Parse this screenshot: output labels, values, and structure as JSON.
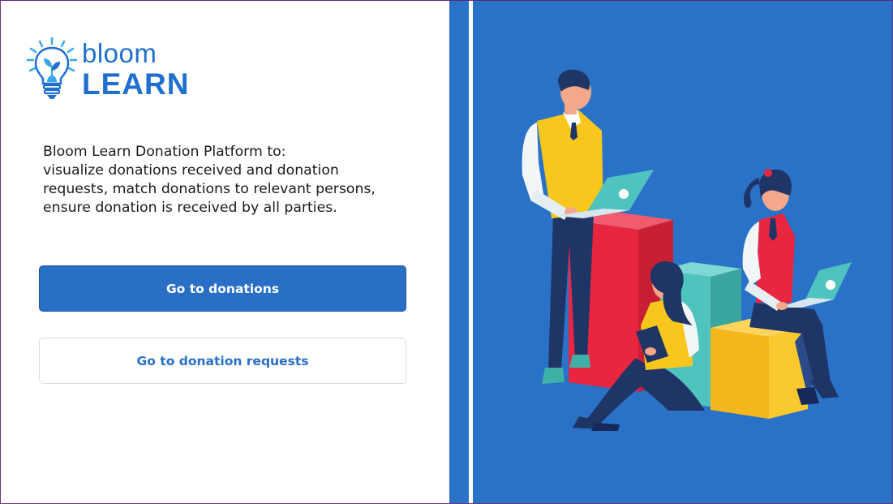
{
  "brand": {
    "logo_word_top": "bloom",
    "logo_word_bottom": "LEARN"
  },
  "description": {
    "lines": [
      "Bloom Learn Donation Platform to:",
      "visualize donations received and donation",
      "requests, match donations to relevant persons,",
      "ensure donation is received by all parties."
    ]
  },
  "actions": {
    "donations_label": "Go to donations",
    "requests_label": "Go to donation requests"
  },
  "colors": {
    "primary": "#2a6fc6",
    "panel_blue": "#2a72c8",
    "logo_blue": "#1f6fd1",
    "block_red": "#e8263f",
    "block_teal": "#4fc3bd",
    "block_yellow": "#f4b71c"
  },
  "illustration": {
    "name": "people-working-on-laptops-illustration"
  }
}
